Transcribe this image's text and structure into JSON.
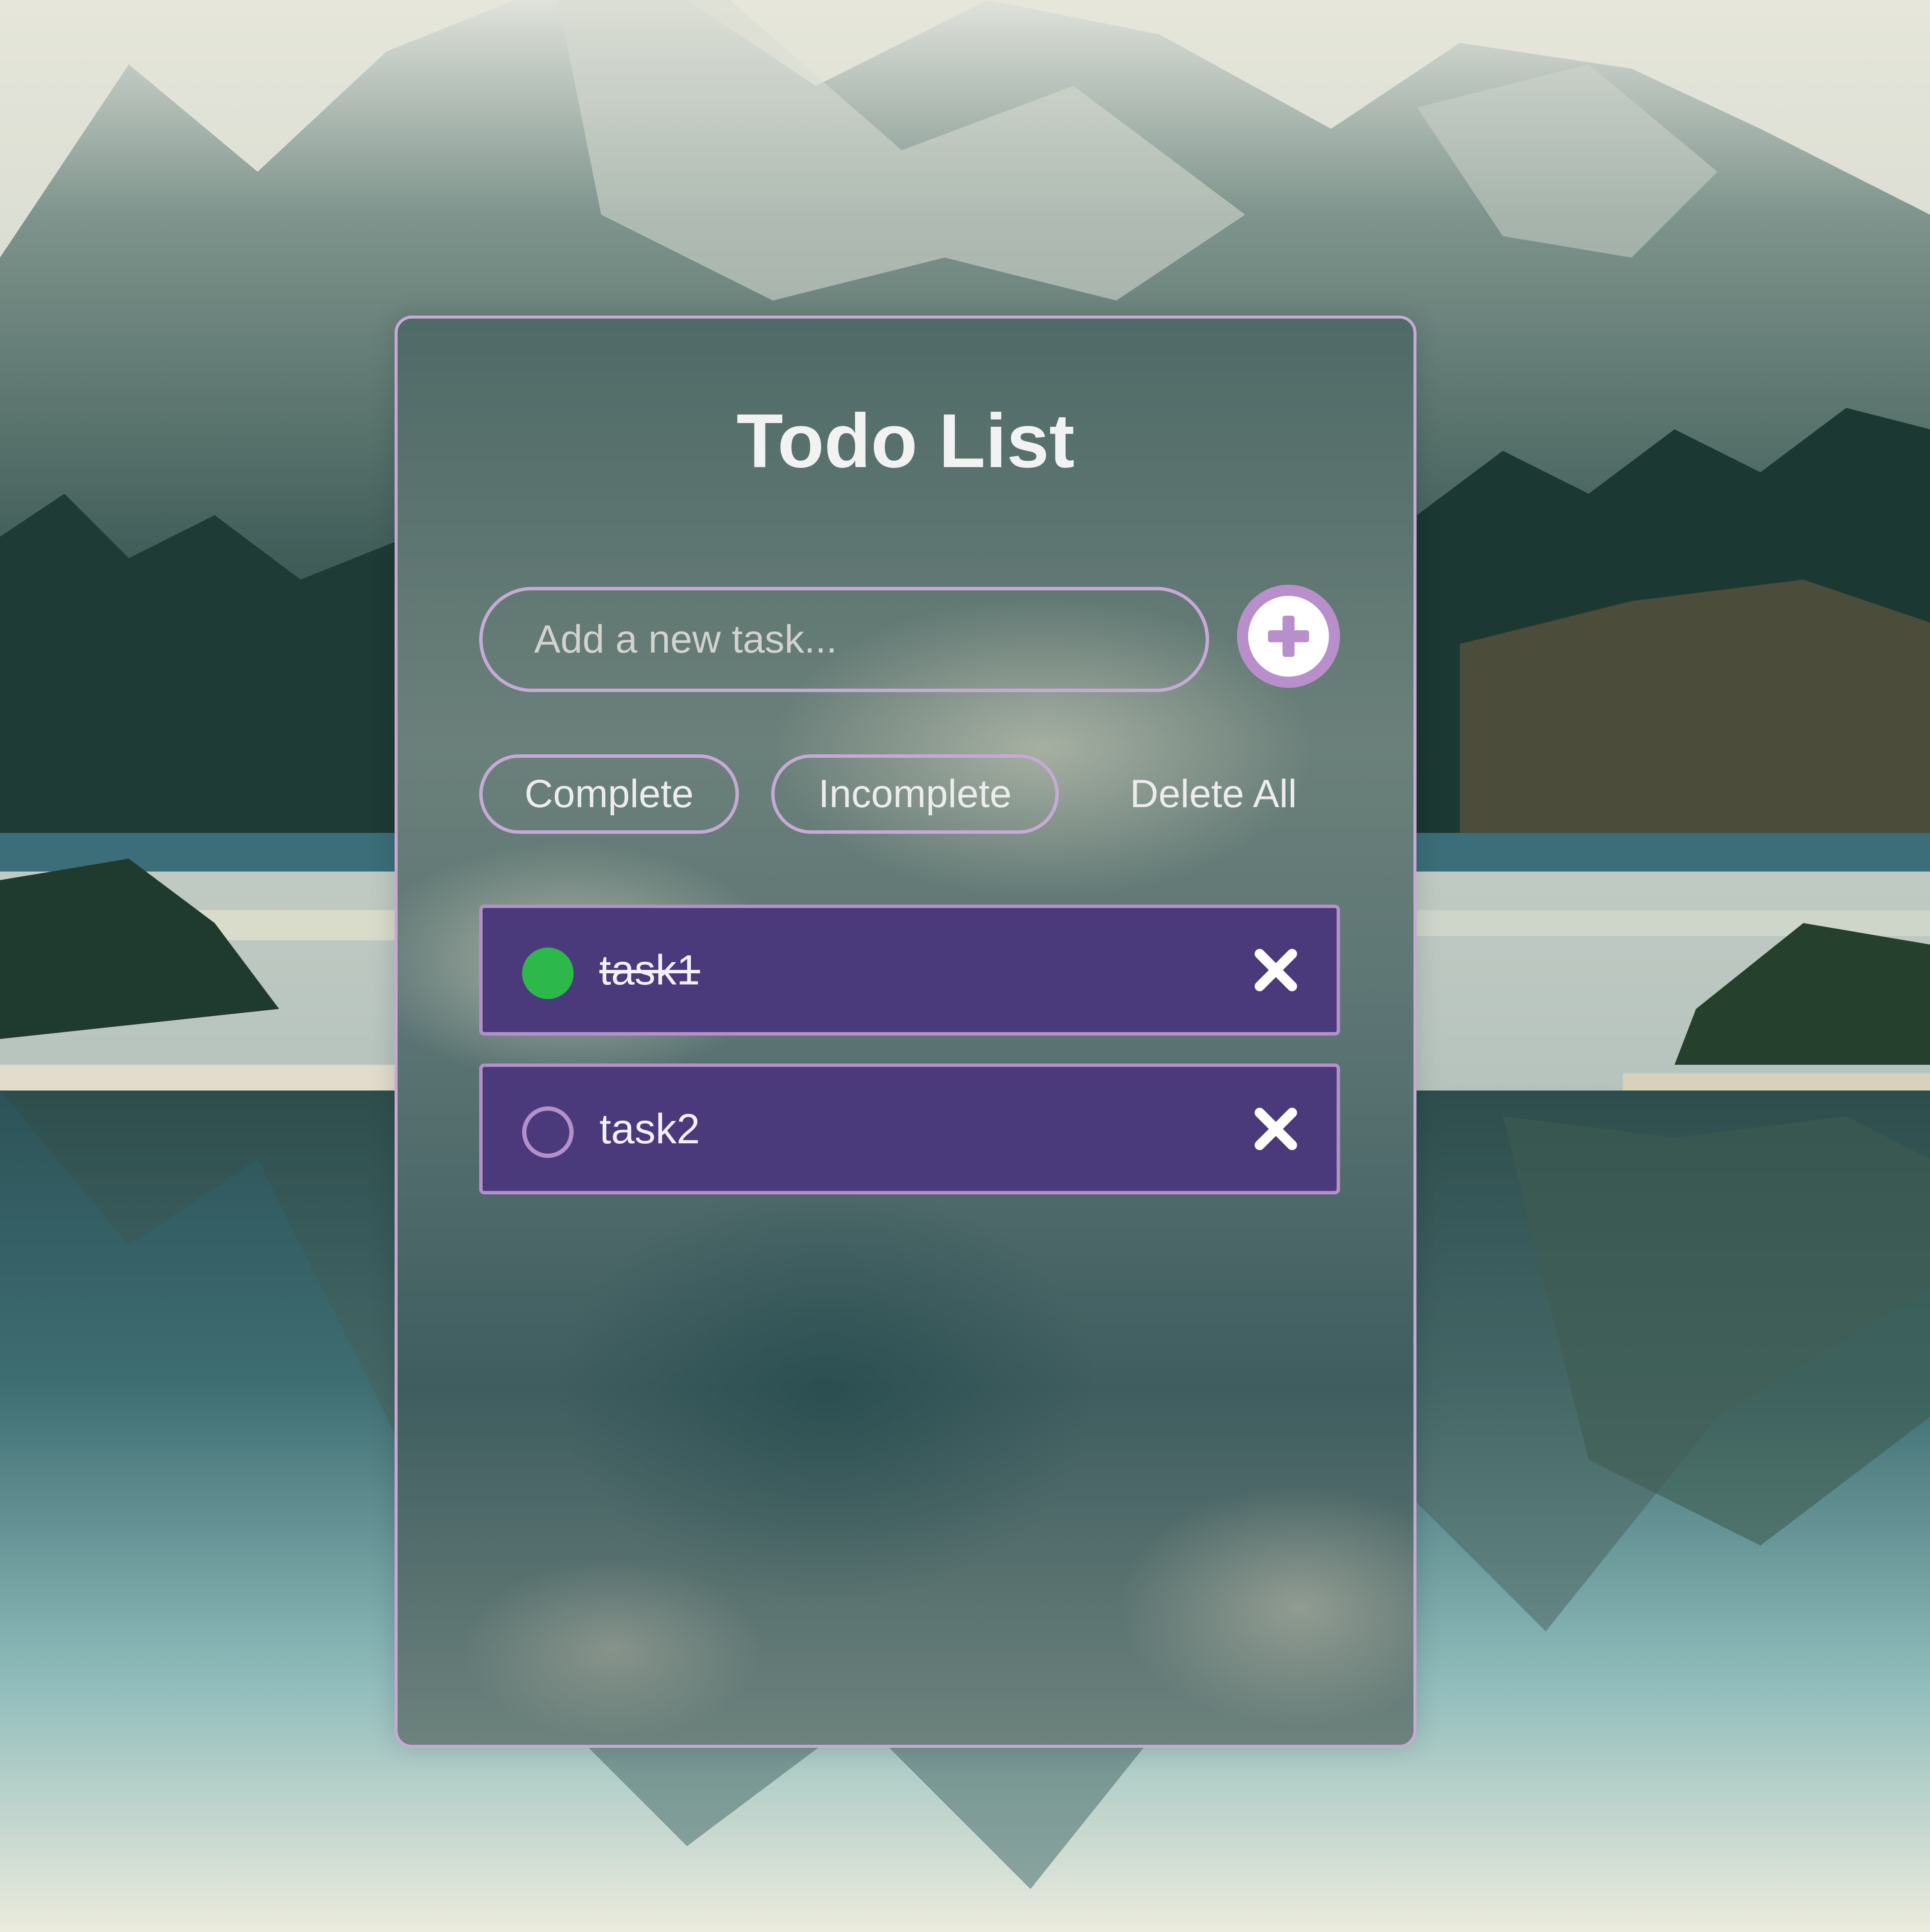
{
  "app": {
    "title": "Todo List"
  },
  "input": {
    "placeholder": "Add a new task...",
    "value": ""
  },
  "add_button": {
    "icon": "plus-icon"
  },
  "filters": {
    "complete": "Complete",
    "incomplete": "Incomplete",
    "delete_all": "Delete All"
  },
  "tasks": [
    {
      "label": "task1",
      "completed": true,
      "status_icon": "checked-circle-icon",
      "delete_icon": "close-icon"
    },
    {
      "label": "task2",
      "completed": false,
      "status_icon": "empty-circle-icon",
      "delete_icon": "close-icon"
    }
  ],
  "colors": {
    "accent": "#c7a9d6",
    "task_bg": "#4a3a7c",
    "done": "#2db84a",
    "add_button": "#b98fcb"
  }
}
